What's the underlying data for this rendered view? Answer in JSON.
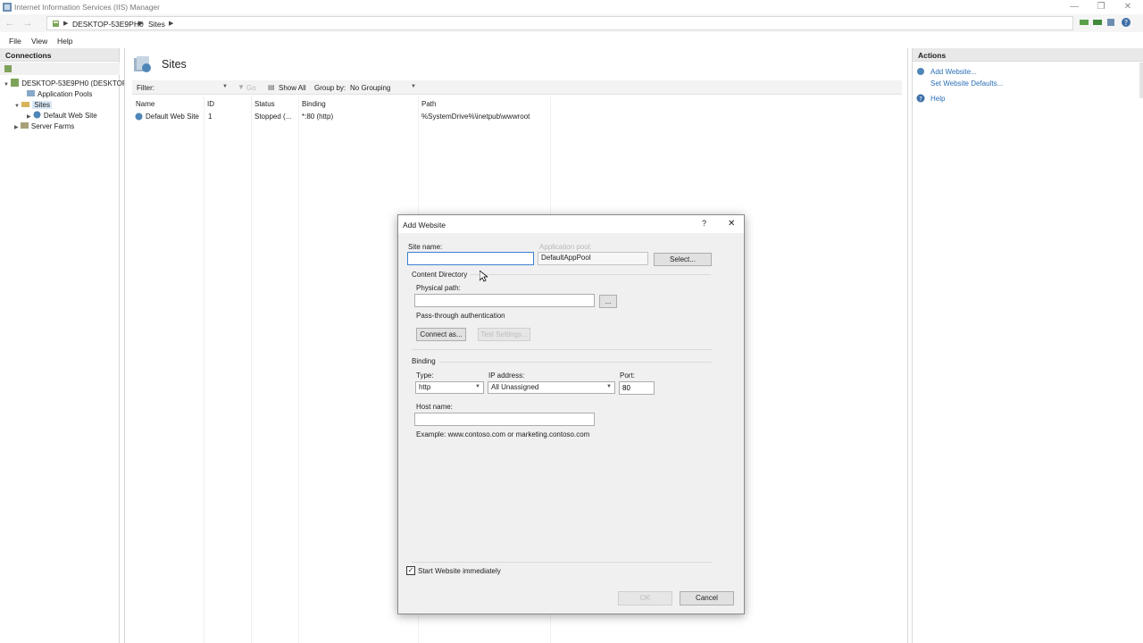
{
  "window": {
    "title": "Internet Information Services (IIS) Manager"
  },
  "address": {
    "crumbs": [
      "DESKTOP-53E9PH0",
      "Sites"
    ]
  },
  "menu": {
    "items": [
      "File",
      "View",
      "Help"
    ]
  },
  "connections": {
    "header": "Connections",
    "tree": {
      "server": "DESKTOP-53E9PH0 (DESKTOP",
      "app_pools": "Application Pools",
      "sites": "Sites",
      "default_site": "Default Web Site",
      "server_farms": "Server Farms"
    }
  },
  "center": {
    "title": "Sites",
    "filter_label": "Filter:",
    "go_label": "Go",
    "show_all_label": "Show All",
    "group_by_label": "Group by:",
    "group_by_value": "No Grouping",
    "columns": [
      "Name",
      "ID",
      "Status",
      "Binding",
      "Path"
    ],
    "rows": [
      {
        "name": "Default Web Site",
        "id": "1",
        "status": "Stopped (...",
        "binding": "*:80 (http)",
        "path": "%SystemDrive%\\inetpub\\wwwroot"
      }
    ]
  },
  "actions": {
    "header": "Actions",
    "add_website": "Add Website...",
    "set_defaults": "Set Website Defaults...",
    "help": "Help"
  },
  "dialog": {
    "title": "Add Website",
    "help_glyph": "?",
    "close_glyph": "✕",
    "site_name_label": "Site name:",
    "site_name_value": "",
    "app_pool_label": "Application pool:",
    "app_pool_value": "DefaultAppPool",
    "select_label": "Select...",
    "content_dir_label": "Content Directory",
    "physical_path_label": "Physical path:",
    "physical_path_value": "",
    "browse_label": "...",
    "passthrough_label": "Pass-through authentication",
    "connect_as_label": "Connect as...",
    "test_settings_label": "Test Settings...",
    "binding_label": "Binding",
    "type_label": "Type:",
    "type_value": "http",
    "ip_label": "IP address:",
    "ip_value": "All Unassigned",
    "port_label": "Port:",
    "port_value": "80",
    "host_label": "Host name:",
    "host_value": "",
    "example_text": "Example: www.contoso.com or marketing.contoso.com",
    "start_label": "Start Website immediately",
    "start_checked": true,
    "ok_label": "OK",
    "cancel_label": "Cancel"
  }
}
